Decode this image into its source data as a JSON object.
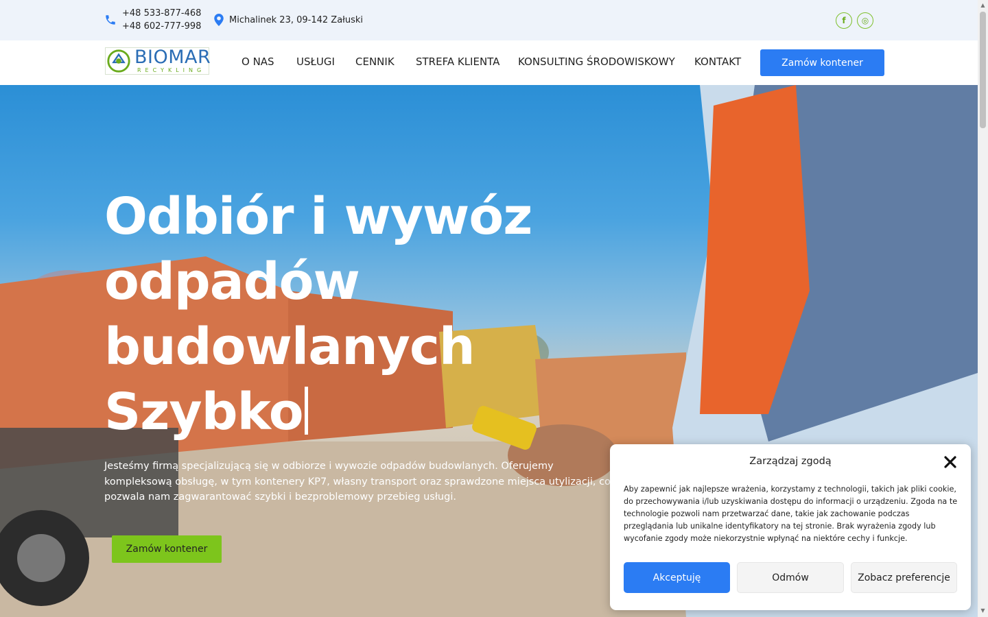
{
  "topbar": {
    "phone1": "+48 533-877-468",
    "phone2": "+48 602-777-998",
    "address": "Michalinek 23, 09-142 Załuski",
    "social": [
      {
        "icon": "facebook-icon",
        "glyph": "f"
      },
      {
        "icon": "instagram-icon",
        "glyph": "◎"
      }
    ]
  },
  "header": {
    "logo_main": "BIOMAR",
    "logo_sub": "RECYKLING",
    "nav": [
      "O NAS",
      "USŁUGI",
      "CENNIK",
      "STREFA KLIENTA",
      "KONSULTING ŚRODOWISKOWY",
      "KONTAKT"
    ],
    "cta": "Zamów kontener"
  },
  "hero": {
    "title_line1": "Odbiór i wywóz",
    "title_line2": "odpadów",
    "title_line3": "budowlanych",
    "title_line4": "Szybko",
    "description": "Jesteśmy firmą specjalizującą się w odbiorze i wywozie odpadów budowlanych. Oferujemy kompleksową obsługę, w tym kontenery KP7, własny transport oraz sprawdzone miejsca utylizacji, co pozwala nam zagwarantować szybki i bezproblemowy przebieg usługi.",
    "cta": "Zamów kontener"
  },
  "cookie": {
    "title": "Zarządzaj zgodą",
    "text": "Aby zapewnić jak najlepsze wrażenia, korzystamy z technologii, takich jak pliki cookie, do przechowywania i/lub uzyskiwania dostępu do informacji o urządzeniu. Zgoda na te technologie pozwoli nam przetwarzać dane, takie jak zachowanie podczas przeglądania lub unikalne identyfikatory na tej stronie. Brak wyrażenia zgody lub wycofanie zgody może niekorzystnie wpłynąć na niektóre cechy i funkcje.",
    "accept": "Akceptuję",
    "deny": "Odmów",
    "preferences": "Zobacz preferencje"
  },
  "colors": {
    "primary_blue": "#2b7cf3",
    "accent_green": "#7dc51c",
    "topbar_bg": "#eef3fa"
  }
}
